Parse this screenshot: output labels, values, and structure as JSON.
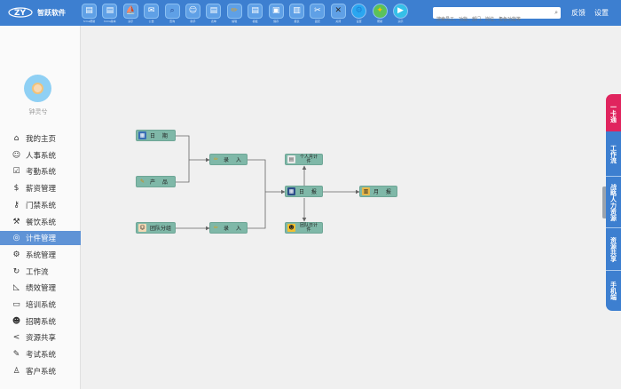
{
  "header": {
    "brand": "智跃软件",
    "search_placeholder": "搜索员工、功能、部门、岗位、角色功能等",
    "links": [
      "反馈",
      "设置"
    ],
    "toolbar": [
      {
        "icon": "document-icon",
        "label": "hrms帮助"
      },
      {
        "icon": "document-icon",
        "label": "hrms版本"
      },
      {
        "icon": "ship-icon",
        "label": "演示"
      },
      {
        "icon": "mail-icon",
        "label": "公告"
      },
      {
        "icon": "search-icon",
        "label": "查询"
      },
      {
        "icon": "robot-icon",
        "label": "助手"
      },
      {
        "icon": "document-icon",
        "label": "表单"
      },
      {
        "icon": "pencil-icon",
        "label": "编辑"
      },
      {
        "icon": "document-icon",
        "label": "模板"
      },
      {
        "icon": "save-icon",
        "label": "保存"
      },
      {
        "icon": "clipboard-icon",
        "label": "报表"
      },
      {
        "icon": "pin-icon",
        "label": "固定"
      },
      {
        "icon": "close-icon",
        "label": "关闭"
      },
      {
        "icon": "gear-icon",
        "label": "设置"
      },
      {
        "icon": "lightbulb-icon",
        "label": "帮助"
      },
      {
        "icon": "play-icon",
        "label": "演示"
      }
    ]
  },
  "colors": {
    "topbar": "#3d7fd0",
    "active_nav": "#5f93d6",
    "node_fill": "#7fb8a8",
    "tab_red": "#e0245e",
    "tab_blue": "#3d7fd0"
  },
  "user": {
    "name": "钟灵兮"
  },
  "sidebar": {
    "items": [
      {
        "label": "我的主页",
        "icon": "home-icon"
      },
      {
        "label": "人事系统",
        "icon": "people-icon"
      },
      {
        "label": "考勤系统",
        "icon": "calendar-check-icon"
      },
      {
        "label": "薪资管理",
        "icon": "money-bag-icon"
      },
      {
        "label": "门禁系统",
        "icon": "key-icon"
      },
      {
        "label": "餐饮系统",
        "icon": "fork-knife-icon"
      },
      {
        "label": "计件管理",
        "icon": "piecework-icon",
        "active": true
      },
      {
        "label": "系统管理",
        "icon": "gear-icon"
      },
      {
        "label": "工作流",
        "icon": "workflow-icon"
      },
      {
        "label": "绩效管理",
        "icon": "chart-icon"
      },
      {
        "label": "培训系统",
        "icon": "monitor-icon"
      },
      {
        "label": "招聘系统",
        "icon": "recruit-icon"
      },
      {
        "label": "资源共享",
        "icon": "share-icon"
      },
      {
        "label": "考试系统",
        "icon": "pen-icon"
      },
      {
        "label": "客户系统",
        "icon": "customer-icon"
      }
    ]
  },
  "flow": {
    "nodes": [
      {
        "id": "riqi",
        "label": "日 期",
        "icon": "calendar-icon"
      },
      {
        "id": "chanpin",
        "label": "产 品",
        "icon": "product-icon"
      },
      {
        "id": "tuandui",
        "label": "团队分组",
        "icon": "team-icon"
      },
      {
        "id": "luru1",
        "label": "录 入",
        "icon": "pencil-icon"
      },
      {
        "id": "luru2",
        "label": "录 入",
        "icon": "pencil-icon"
      },
      {
        "id": "geren",
        "label": "个人月计件",
        "icon": "calendar-grid-icon"
      },
      {
        "id": "ribao",
        "label": "日 报",
        "icon": "calendar-icon"
      },
      {
        "id": "tuandui_ri",
        "label": "团队日计件",
        "icon": "team-icon"
      },
      {
        "id": "yuebao",
        "label": "月 报",
        "icon": "report-icon"
      }
    ]
  },
  "right_tabs": [
    {
      "label": "一卡通"
    },
    {
      "label": "工作流"
    },
    {
      "label": "战略人力资源"
    },
    {
      "label": "资源共享"
    },
    {
      "label": "手机端"
    }
  ]
}
